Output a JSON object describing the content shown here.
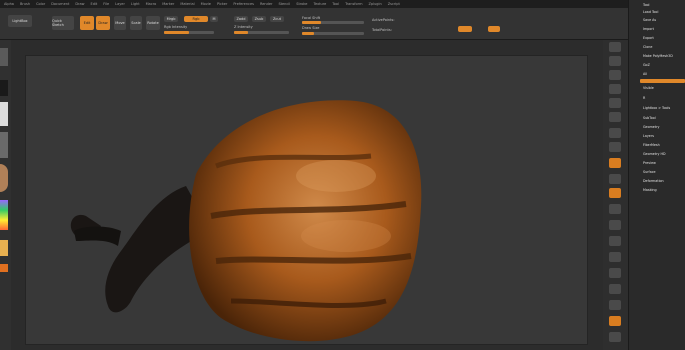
{
  "menu": [
    "Alpha",
    "Brush",
    "Color",
    "Document",
    "Draw",
    "Edit",
    "File",
    "Layer",
    "Light",
    "Macro",
    "Marker",
    "Material",
    "Movie",
    "Picker",
    "Preferences",
    "Render",
    "Stencil",
    "Stroke",
    "Texture",
    "Tool",
    "Transform",
    "Zplugin",
    "Zscript"
  ],
  "toolbar": {
    "lightbox_label": "LightBox",
    "quick_sketch_label": "Quick Sketch",
    "edit_label": "Edit",
    "draw_label": "Draw",
    "move_label": "Move",
    "scale_label": "Scale",
    "rotate_label": "Rotate",
    "mrgb_label": "Mrgb",
    "rgb_label": "Rgb",
    "m_label": "M",
    "zadd_label": "Zadd",
    "zsub_label": "Zsub",
    "zcut_label": "Zcut",
    "rgb_intensity_label": "Rgb Intensity",
    "z_intensity_label": "Z Intensity",
    "focal_shift_label": "Focal Shift",
    "draw_size_label": "Draw Size",
    "active_points_label": "ActivePoints:",
    "total_points_label": "TotalPoints:",
    "rgb_intensity": 0.5,
    "z_intensity": 0.25,
    "focal_shift": 0.3,
    "draw_size": 0.2
  },
  "left_colors": [
    "#5a5a5a",
    "#dcdcdc",
    "#777777",
    "#c8a070",
    "#9966ff",
    "#e8b050",
    "#e07020"
  ],
  "right_panel": {
    "items": [
      "Tool",
      "Load Tool",
      "Save As",
      "Import",
      "Export",
      "Clone",
      "Make PolyMesh3D",
      "GoZ",
      "All",
      "Visible",
      "R",
      "Lightbox > Tools",
      "SubTool",
      "Geometry",
      "Layers",
      "FiberMesh",
      "Geometry HD",
      "Preview",
      "Surface",
      "Deformation",
      "Masking",
      "Visibility",
      "Polygroups",
      "Contact",
      "Morph Target",
      "Polypaint",
      "UV Map",
      "Texture Map",
      "Displacement Map",
      "Normal Map"
    ],
    "colors": {
      "accent": "#e0882a"
    }
  },
  "right_shelf_icons": [
    "bpr-icon",
    "spix-icon",
    "scroll-icon",
    "zoom-icon",
    "actual-icon",
    "aahalf-icon",
    "persp-icon",
    "floor-icon",
    "local-icon",
    "lsym-icon",
    "xyz-icon",
    "frame-icon",
    "move-icon",
    "scale-icon",
    "rotate-icon",
    "linefill-icon",
    "transp-icon",
    "ghost-icon",
    "solo-icon",
    "xpose-icon"
  ],
  "model": {
    "description_color_main": "#b5651d",
    "stem_color": "#1a1614"
  }
}
